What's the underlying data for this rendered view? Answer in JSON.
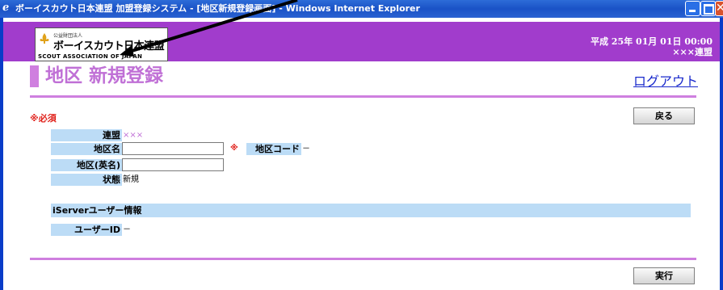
{
  "window": {
    "title": "ボーイスカウト日本連盟 加盟登録システム - [地区新規登録画面] - Windows Internet Explorer"
  },
  "header": {
    "logo": {
      "org_type": "公益財団法人",
      "name": "ボーイスカウト日本連盟",
      "name_en": "SCOUT ASSOCIATION OF JAPAN"
    },
    "date": "平成 25年 01月 01日 00:00",
    "federation": "×××連盟"
  },
  "page": {
    "title": "地区  新規登録",
    "logout": "ログアウト",
    "required_note": "※必須",
    "back_button": "戻る",
    "execute_button": "実行"
  },
  "form": {
    "federation_label": "連盟",
    "federation_value": "×××",
    "district_name_label": "地区名",
    "district_name_value": "",
    "required_mark": "※",
    "district_code_label": "地区コード",
    "district_code_value": "－",
    "district_en_label": "地区(英名)",
    "district_en_value": "",
    "status_label": "状態",
    "status_value": "新規"
  },
  "iserver": {
    "section_title": "iServerユーザー情報",
    "user_id_label": "ユーザーID",
    "user_id_value": "－"
  },
  "colors": {
    "header": "#a13ccc",
    "accent": "#cf7fdf",
    "label_bg": "#bcdcf6",
    "required": "#e0201a",
    "link": "#1a2acc"
  }
}
